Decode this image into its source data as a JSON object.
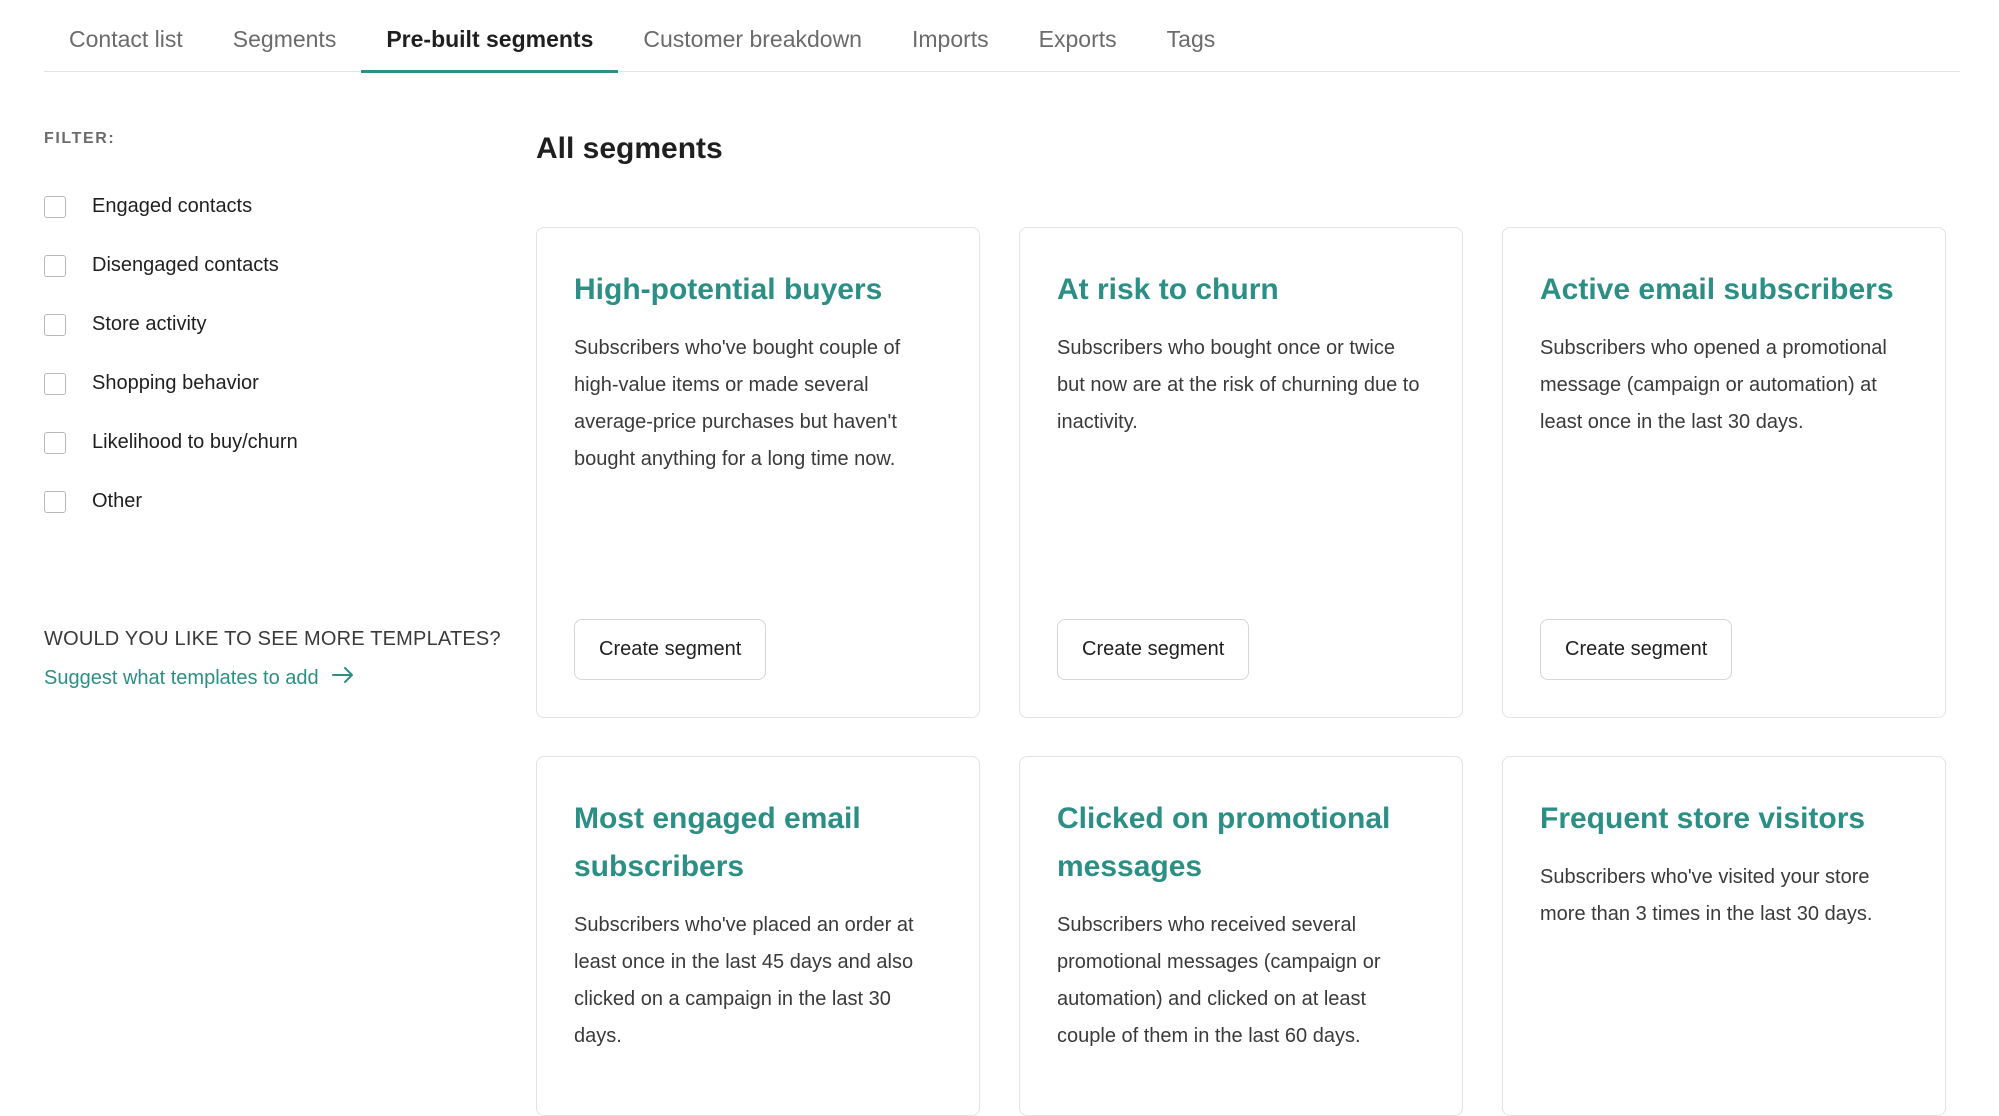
{
  "tabs": [
    {
      "label": "Contact list",
      "active": false
    },
    {
      "label": "Segments",
      "active": false
    },
    {
      "label": "Pre-built segments",
      "active": true
    },
    {
      "label": "Customer breakdown",
      "active": false
    },
    {
      "label": "Imports",
      "active": false
    },
    {
      "label": "Exports",
      "active": false
    },
    {
      "label": "Tags",
      "active": false
    }
  ],
  "sidebar": {
    "filter_heading": "FILTER:",
    "filters": [
      {
        "label": "Engaged contacts",
        "checked": false
      },
      {
        "label": "Disengaged contacts",
        "checked": false
      },
      {
        "label": "Store activity",
        "checked": false
      },
      {
        "label": "Shopping behavior",
        "checked": false
      },
      {
        "label": "Likelihood to buy/churn",
        "checked": false
      },
      {
        "label": "Other",
        "checked": false
      }
    ],
    "more_templates_heading": "WOULD YOU LIKE TO SEE MORE TEMPLATES?",
    "suggest_link": "Suggest what templates to add",
    "suggest_icon": "arrow-right-icon"
  },
  "main": {
    "title": "All segments",
    "cards": [
      {
        "title": "High-potential buyers",
        "description": "Subscribers who've bought couple of high-value items or made several average-price purchases but haven't bought anything for a long time now.",
        "button": "Create segment"
      },
      {
        "title": "At risk to churn",
        "description": "Subscribers who bought once or twice but now are at the risk of churning due to inactivity.",
        "button": "Create segment"
      },
      {
        "title": "Active email subscribers",
        "description": "Subscribers who opened a promotional message (campaign or automation) at least once in the last 30 days.",
        "button": "Create segment"
      },
      {
        "title": "Most engaged email subscribers",
        "description": "Subscribers who've placed an order at least once in the last 45 days and also clicked on a campaign in the last 30 days.",
        "button": ""
      },
      {
        "title": "Clicked on promotional messages",
        "description": "Subscribers who received several promotional messages (campaign or automation) and clicked on at least couple of them in the last 60 days.",
        "button": ""
      },
      {
        "title": "Frequent store visitors",
        "description": "Subscribers who've visited your store more than 3 times in the last 30 days.",
        "button": ""
      }
    ]
  },
  "colors": {
    "accent": "#2c8f86",
    "text": "#1f1f1f",
    "muted": "#6b6b6b",
    "border": "#e3e3e3"
  }
}
